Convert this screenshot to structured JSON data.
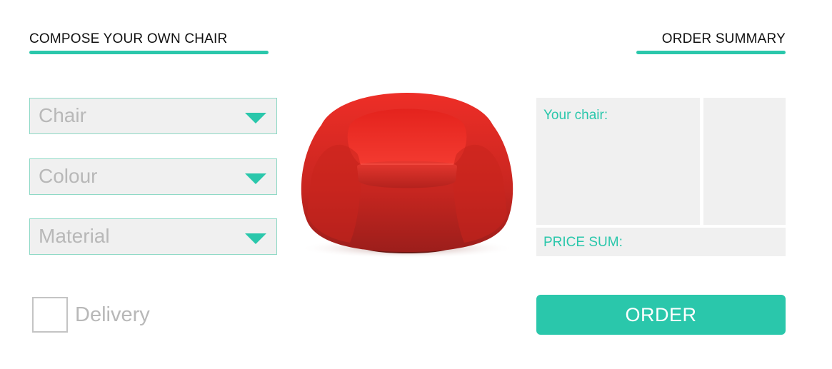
{
  "colors": {
    "accent": "#2ac7ab",
    "panel_bg": "#f0f0f0",
    "placeholder_text": "#b8b8b8",
    "chair_red": "#e0251f"
  },
  "composer": {
    "title": "COMPOSE YOUR OWN CHAIR",
    "selects": {
      "chair": "Chair",
      "colour": "Colour",
      "material": "Material"
    },
    "delivery_label": "Delivery",
    "delivery_checked": false
  },
  "preview": {
    "image_icon": "red-armchair-image"
  },
  "summary": {
    "title": "ORDER SUMMARY",
    "your_chair_label": "Your chair:",
    "price_sum_label": "PRICE SUM:",
    "order_button": "ORDER"
  }
}
